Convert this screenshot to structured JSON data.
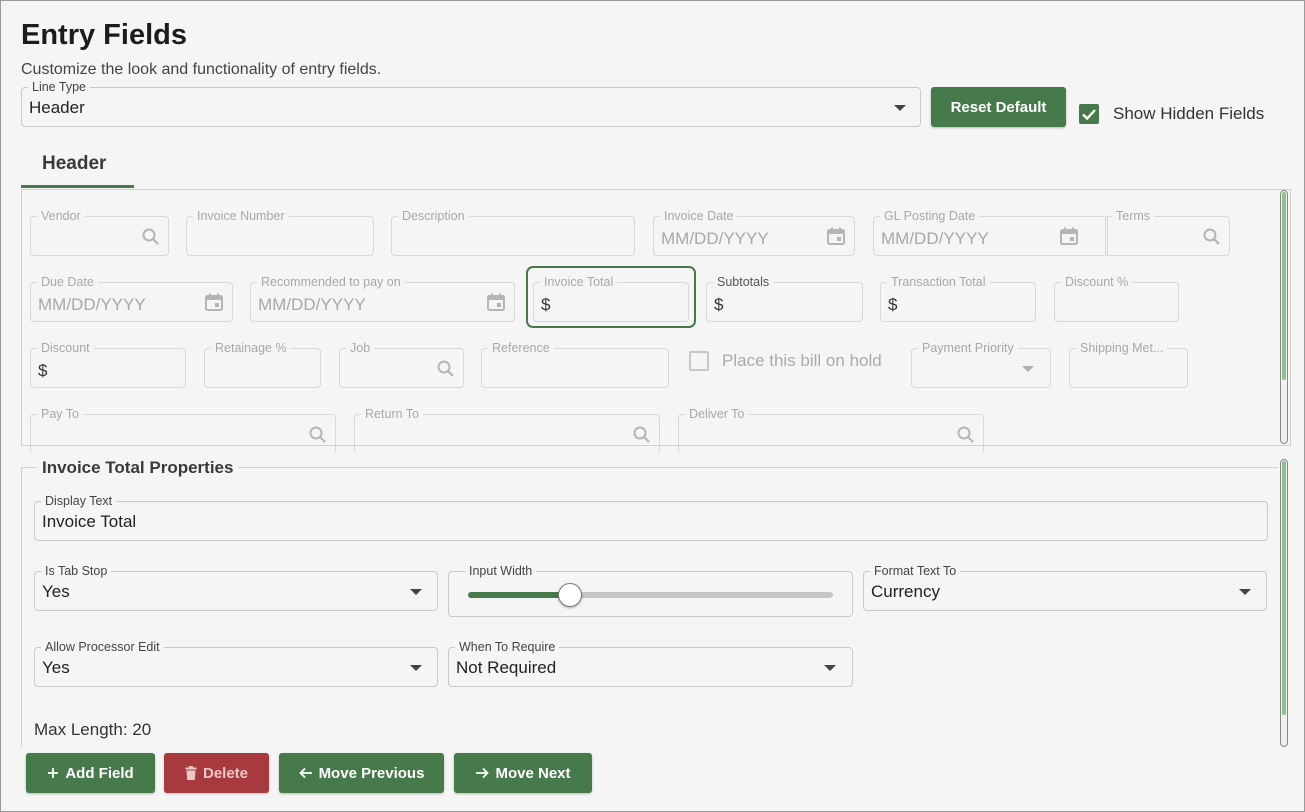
{
  "page": {
    "title": "Entry Fields",
    "subtitle": "Customize the look and functionality of entry fields."
  },
  "line_type": {
    "label": "Line Type",
    "value": "Header"
  },
  "reset_default_label": "Reset Default",
  "show_hidden": {
    "label": "Show Hidden Fields",
    "checked": true
  },
  "tab": {
    "label": "Header"
  },
  "header_fields": {
    "vendor": {
      "label": "Vendor",
      "value": ""
    },
    "invoice_number": {
      "label": "Invoice Number",
      "value": ""
    },
    "description": {
      "label": "Description",
      "value": ""
    },
    "invoice_date": {
      "label": "Invoice Date",
      "placeholder": "MM/DD/YYYY"
    },
    "gl_posting_date": {
      "label": "GL Posting Date",
      "placeholder": "MM/DD/YYYY"
    },
    "terms": {
      "label": "Terms",
      "value": ""
    },
    "due_date": {
      "label": "Due Date",
      "placeholder": "MM/DD/YYYY"
    },
    "recommended_pay": {
      "label": "Recommended to pay on",
      "placeholder": "MM/DD/YYYY"
    },
    "invoice_total": {
      "label": "Invoice Total",
      "value": "$",
      "selected": true
    },
    "subtotals": {
      "label": "Subtotals",
      "value": "$"
    },
    "transaction_total": {
      "label": "Transaction Total",
      "value": "$"
    },
    "discount_pct": {
      "label": "Discount %",
      "value": ""
    },
    "discount": {
      "label": "Discount",
      "value": "$"
    },
    "retainage_pct": {
      "label": "Retainage %",
      "value": ""
    },
    "job": {
      "label": "Job",
      "value": ""
    },
    "reference": {
      "label": "Reference",
      "value": ""
    },
    "hold": {
      "label": "Place this bill on hold",
      "checked": false
    },
    "payment_priority": {
      "label": "Payment Priority",
      "value": ""
    },
    "shipping_method": {
      "label": "Shipping Met...",
      "value": ""
    },
    "pay_to": {
      "label": "Pay To",
      "value": ""
    },
    "return_to": {
      "label": "Return To",
      "value": ""
    },
    "deliver_to": {
      "label": "Deliver To",
      "value": ""
    }
  },
  "properties": {
    "title": "Invoice Total Properties",
    "display_text": {
      "label": "Display Text",
      "value": "Invoice Total"
    },
    "is_tab_stop": {
      "label": "Is Tab Stop",
      "value": "Yes"
    },
    "input_width": {
      "label": "Input Width",
      "value_fraction": 0.28
    },
    "format_text_to": {
      "label": "Format Text To",
      "value": "Currency"
    },
    "allow_processor_edit": {
      "label": "Allow Processor Edit",
      "value": "Yes"
    },
    "when_to_require": {
      "label": "When To Require",
      "value": "Not Required"
    },
    "max_length": "Max Length: 20"
  },
  "buttons": {
    "add_field": "Add Field",
    "delete": "Delete",
    "move_previous": "Move Previous",
    "move_next": "Move Next"
  },
  "colors": {
    "accent": "#467a4b",
    "danger": "#a83a3f",
    "scroll_thumb": "#8cc28c"
  },
  "icons": {
    "search": "search-icon",
    "calendar": "calendar-icon",
    "dropdown": "chevron-down-icon",
    "check": "check-icon",
    "plus": "plus-icon",
    "trash": "trash-icon",
    "arrow_left": "arrow-left-icon",
    "arrow_right": "arrow-right-icon"
  }
}
